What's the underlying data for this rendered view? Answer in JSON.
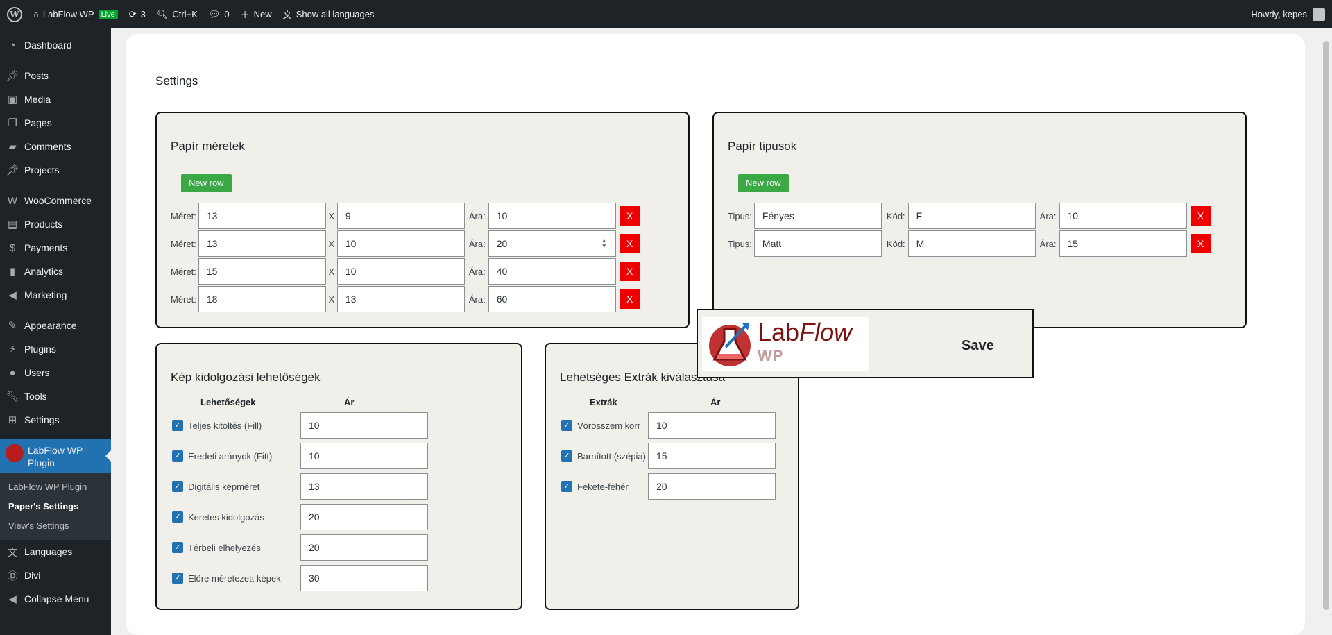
{
  "adminbar": {
    "site_name": "LabFlow WP",
    "live_badge": "Live",
    "updates_count": "3",
    "search_shortcut": "Ctrl+K",
    "comments_count": "0",
    "new_label": "New",
    "languages_label": "Show all languages",
    "howdy": "Howdy, kepes"
  },
  "sidebar": {
    "items": [
      {
        "label": "Dashboard",
        "icon": "dashboard-icon"
      },
      {
        "label": "Posts",
        "icon": "pin-icon"
      },
      {
        "label": "Media",
        "icon": "media-icon"
      },
      {
        "label": "Pages",
        "icon": "pages-icon"
      },
      {
        "label": "Comments",
        "icon": "comment-icon"
      },
      {
        "label": "Projects",
        "icon": "pin-icon"
      },
      {
        "label": "WooCommerce",
        "icon": "woo-icon"
      },
      {
        "label": "Products",
        "icon": "archive-icon"
      },
      {
        "label": "Payments",
        "icon": "dollar-icon"
      },
      {
        "label": "Analytics",
        "icon": "chart-icon"
      },
      {
        "label": "Marketing",
        "icon": "megaphone-icon"
      },
      {
        "label": "Appearance",
        "icon": "brush-icon"
      },
      {
        "label": "Plugins",
        "icon": "plug-icon"
      },
      {
        "label": "Users",
        "icon": "user-icon"
      },
      {
        "label": "Tools",
        "icon": "wrench-icon"
      },
      {
        "label": "Settings",
        "icon": "settings-icon"
      }
    ],
    "current": "LabFlow WP Plugin",
    "submenu": [
      "LabFlow WP Plugin",
      "Paper's Settings",
      "View's Settings"
    ],
    "after": [
      {
        "label": "Languages",
        "icon": "translate-icon"
      },
      {
        "label": "Divi",
        "icon": "divi-icon"
      },
      {
        "label": "Collapse Menu",
        "icon": "collapse-icon"
      }
    ]
  },
  "page": {
    "title": "Settings"
  },
  "paper_sizes": {
    "title": "Papír méretek",
    "new_row": "New row",
    "label_size": "Méret:",
    "label_x": "X",
    "label_price": "Ára:",
    "delete_label": "X",
    "rows": [
      {
        "w": "13",
        "h": "9",
        "price": "10"
      },
      {
        "w": "13",
        "h": "10",
        "price": "20"
      },
      {
        "w": "15",
        "h": "10",
        "price": "40"
      },
      {
        "w": "18",
        "h": "13",
        "price": "60"
      }
    ]
  },
  "paper_types": {
    "title": "Papír tipusok",
    "new_row": "New row",
    "label_type": "Tipus:",
    "label_code": "Kód:",
    "label_price": "Ára:",
    "delete_label": "X",
    "rows": [
      {
        "type": "Fényes",
        "code": "F",
        "price": "10"
      },
      {
        "type": "Matt",
        "code": "M",
        "price": "15"
      }
    ]
  },
  "finishing": {
    "title": "Kép kidolgozási lehetőségek",
    "col_options": "Lehetőségek",
    "col_price": "Ár",
    "rows": [
      {
        "name": "Teljes kitöltés (Fill)",
        "price": "10",
        "checked": true
      },
      {
        "name": "Eredeti arányok (Fitt)",
        "price": "10",
        "checked": true
      },
      {
        "name": "Digitális képméret",
        "price": "13",
        "checked": true
      },
      {
        "name": "Keretes kidolgozás",
        "price": "20",
        "checked": true
      },
      {
        "name": "Térbeli elhelyezés",
        "price": "20",
        "checked": true
      },
      {
        "name": "Előre méretezett képek",
        "price": "30",
        "checked": true
      }
    ]
  },
  "extras": {
    "title": "Lehetséges Extrák kiválasztása",
    "col_extras": "Extrák",
    "col_price": "Ár",
    "rows": [
      {
        "name": "Vörösszem korr",
        "price": "10",
        "checked": true
      },
      {
        "name": "Barnított (szépia)",
        "price": "15",
        "checked": true
      },
      {
        "name": "Fekete-fehér",
        "price": "20",
        "checked": true
      }
    ]
  },
  "save_panel": {
    "brand_main": "Lab",
    "brand_italic": "Flow",
    "brand_sub": "WP",
    "save_label": "Save"
  },
  "colors": {
    "accent": "#2271b1",
    "new_row": "#3aa845",
    "delete": "#ee0000",
    "panel_bg": "#f0efea"
  }
}
